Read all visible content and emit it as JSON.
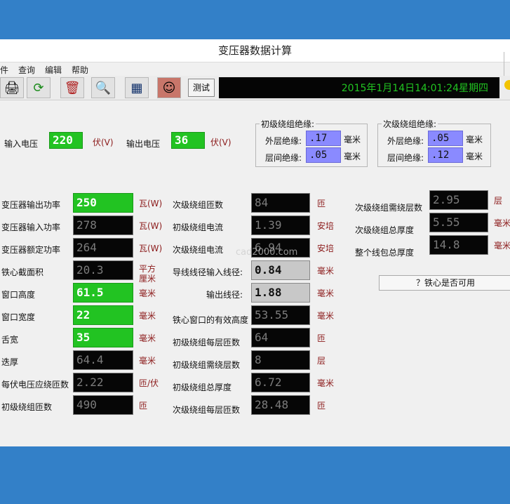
{
  "window": {
    "title": "变压器数据计算"
  },
  "menu": {
    "items": [
      "件",
      "查询",
      "编辑",
      "帮助"
    ]
  },
  "toolbar": {
    "icons": [
      "printer-icon",
      "refresh-icon",
      "recycle-bin-icon",
      "magnifier-icon",
      "calculator-icon",
      "character-portrait-icon"
    ],
    "test_label": "测试",
    "datetime": "2015年1月14日14:01:24星期四"
  },
  "inputs": {
    "voltage_in_label": "输入电压",
    "voltage_in_value": "220",
    "voltage_in_unit": "伏(V)",
    "voltage_out_label": "输出电压",
    "voltage_out_value": "36",
    "voltage_out_unit": "伏(V)"
  },
  "primary_insulation": {
    "legend": "初级绕组绝缘:",
    "outer_label": "外层绝缘:",
    "outer_value": ".17",
    "outer_unit": "毫米",
    "inter_label": "层间绝缘:",
    "inter_value": ".05",
    "inter_unit": "毫米"
  },
  "secondary_insulation": {
    "legend": "次级绕组绝缘:",
    "outer_label": "外层绝缘:",
    "outer_value": ".05",
    "outer_unit": "毫米",
    "inter_label": "层间绝缘:",
    "inter_value": ".12",
    "inter_unit": "毫米"
  },
  "left_fields": [
    {
      "label": "变压器输出功率",
      "value": "250",
      "unit": "瓦(W)"
    },
    {
      "label": "变压器输入功率",
      "value": "278",
      "unit": "瓦(W)"
    },
    {
      "label": "变压器额定功率",
      "value": "264",
      "unit": "瓦(W)"
    },
    {
      "label": "铁心截面积",
      "value": "20.3",
      "unit": "平方\n厘米"
    },
    {
      "label": "窗口高度",
      "value": "61.5",
      "unit": "毫米"
    },
    {
      "label": "窗口宽度",
      "value": "22",
      "unit": "毫米"
    },
    {
      "label": "舌宽",
      "value": "35",
      "unit": "毫米"
    },
    {
      "label": "迭厚",
      "value": "64.4",
      "unit": "毫米"
    },
    {
      "label": "每伏电压应绕匝数",
      "value": "2.22",
      "unit": "匝/伏"
    },
    {
      "label": "初级绕组匝数",
      "value": "490",
      "unit": "匝"
    }
  ],
  "middle_fields": [
    {
      "label": "次级绕组匝数",
      "value": "84",
      "unit": "匝"
    },
    {
      "label": "初级绕组电流",
      "value": "1.39",
      "unit": "安培"
    },
    {
      "label": "次级绕组电流",
      "value": "6.94",
      "unit": "安培"
    },
    {
      "label": "导线线径输入线径:",
      "value": "0.84",
      "unit": "毫米"
    },
    {
      "label": "输出线径:",
      "value": "1.88",
      "unit": "毫米"
    },
    {
      "label": "铁心窗口的有效高度",
      "value": "53.55",
      "unit": "毫米"
    },
    {
      "label": "初级绕组每层匝数",
      "value": "64",
      "unit": "匝"
    },
    {
      "label": "初级绕组需绕层数",
      "value": "8",
      "unit": "层"
    },
    {
      "label": "初级绕组总厚度",
      "value": "6.72",
      "unit": "毫米"
    },
    {
      "label": "次级绕组每层匝数",
      "value": "28.48",
      "unit": "匝"
    }
  ],
  "right_fields": [
    {
      "label": "次级绕组需绕层数",
      "value": "2.95",
      "unit": "层"
    },
    {
      "label": "次级绕组总厚度",
      "value": "5.55",
      "unit": "毫米"
    },
    {
      "label": "整个线包总厚度",
      "value": "14.8",
      "unit": "毫米"
    }
  ],
  "check_button": "？铁心是否可用",
  "watermark": "cad2000.com"
}
